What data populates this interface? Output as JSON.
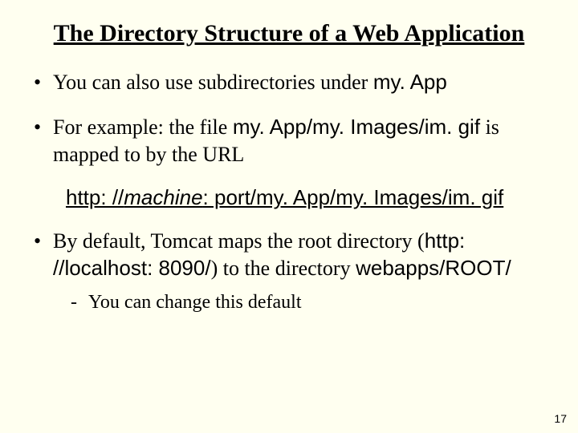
{
  "title": "The Directory Structure of a Web Application",
  "bullets": {
    "b1_pre": "You can also use subdirectories under ",
    "b1_code": "my. App",
    "b2_pre": "For example: the file ",
    "b2_code": "my. App/my. Images/im. gif",
    "b2_post": " is mapped to by the URL",
    "link_pre": "http: //",
    "link_machine": "machine",
    "link_post": ": port/my. App/my. Images/im. gif",
    "b3_pre": "By default, Tomcat maps the root directory (",
    "b3_url": "http: //localhost: 8090/",
    "b3_mid": ") to the directory ",
    "b3_dir": "webapps/ROOT/",
    "sub1": "You can change this default"
  },
  "page_number": "17"
}
